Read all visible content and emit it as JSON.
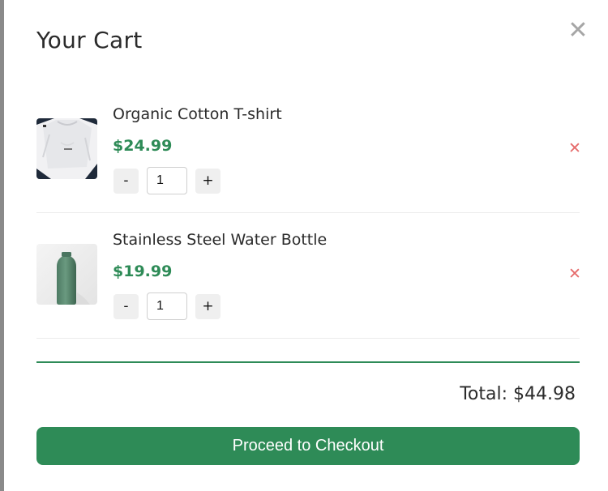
{
  "cart": {
    "title": "Your Cart",
    "close_icon": "close-icon",
    "items": [
      {
        "name": "Organic Cotton T-shirt",
        "price": "$24.99",
        "quantity": "1",
        "image_icon": "tshirt-image",
        "decrement_label": "-",
        "increment_label": "+",
        "remove_icon": "remove-icon"
      },
      {
        "name": "Stainless Steel Water Bottle",
        "price": "$19.99",
        "quantity": "1",
        "image_icon": "water-bottle-image",
        "decrement_label": "-",
        "increment_label": "+",
        "remove_icon": "remove-icon"
      }
    ],
    "total_label": "Total: $44.98",
    "checkout_label": "Proceed to Checkout"
  },
  "colors": {
    "accent": "#2e8b57",
    "remove": "#e66b6b",
    "close": "#a6a6a6",
    "text": "#2b2b2b"
  }
}
